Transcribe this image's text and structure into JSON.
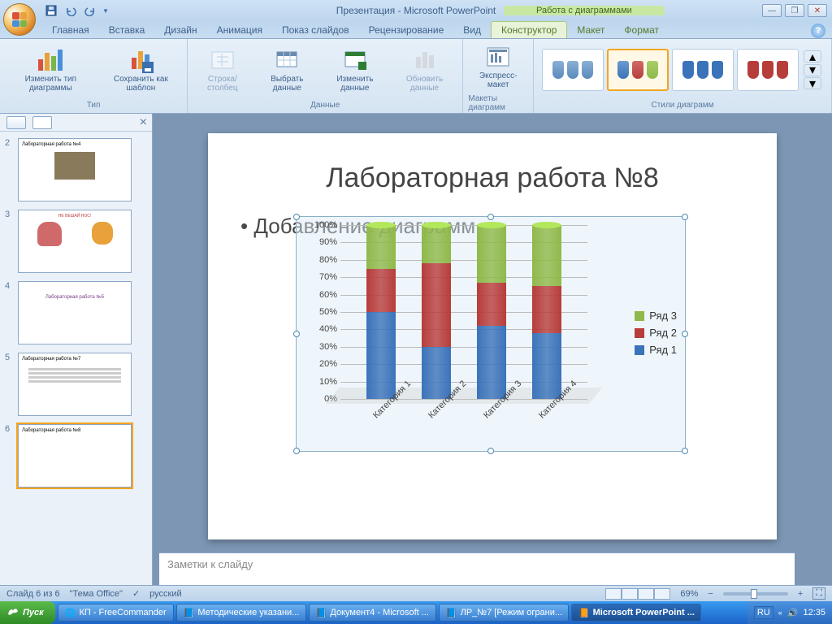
{
  "title_app": "Презентация - Microsoft PowerPoint",
  "title_context": "Работа с диаграммами",
  "tabs": {
    "home": "Главная",
    "insert": "Вставка",
    "design": "Дизайн",
    "anim": "Анимация",
    "slideshow": "Показ слайдов",
    "review": "Рецензирование",
    "view": "Вид",
    "chart_design": "Конструктор",
    "chart_layout": "Макет",
    "chart_format": "Формат"
  },
  "ribbon": {
    "type_group": "Тип",
    "change_type": "Изменить тип\nдиаграммы",
    "save_template": "Сохранить\nкак шаблон",
    "data_group": "Данные",
    "switch_rc": "Строка/столбец",
    "select_data": "Выбрать\nданные",
    "edit_data": "Изменить\nданные",
    "refresh_data": "Обновить\nданные",
    "layouts_group": "Макеты диаграмм",
    "express_layout": "Экспресс-макет",
    "styles_group": "Стили диаграмм"
  },
  "slide": {
    "title": "Лабораторная работа №8",
    "bullet": "Добавление диаграмм"
  },
  "legend": {
    "s1": "Ряд 1",
    "s2": "Ряд 2",
    "s3": "Ряд 3"
  },
  "notes_placeholder": "Заметки к слайду",
  "status": {
    "slide": "Слайд 6 из 6",
    "theme": "\"Тема Office\"",
    "lang": "русский",
    "zoom": "69%"
  },
  "thumbs": {
    "t2": "Лабораторная работа №4",
    "t4": "Лабораторная работа №5",
    "t5": "Лабораторная работа №7",
    "t6": "Лабораторная работа №8"
  },
  "taskbar": {
    "start": "Пуск",
    "t1": "КП - FreeCommander",
    "t2": "Методические указани...",
    "t3": "Документ4 - Microsoft ...",
    "t4": "ЛР_№7 [Режим ограни...",
    "t5": "Microsoft PowerPoint ...",
    "lang": "RU",
    "clock": "12:35"
  },
  "chart_data": {
    "type": "bar",
    "stacked": true,
    "percent": true,
    "categories": [
      "Категория 1",
      "Категория 2",
      "Категория 3",
      "Категория 4"
    ],
    "series": [
      {
        "name": "Ряд 1",
        "values": [
          50,
          30,
          42,
          38
        ],
        "color": "#3b73ba"
      },
      {
        "name": "Ряд 2",
        "values": [
          25,
          48,
          25,
          27
        ],
        "color": "#b73d3b"
      },
      {
        "name": "Ряд 3",
        "values": [
          25,
          22,
          33,
          35
        ],
        "color": "#8fb94a"
      }
    ],
    "ylabel": "",
    "ylim": [
      0,
      100
    ],
    "yticks": [
      "0%",
      "10%",
      "20%",
      "30%",
      "40%",
      "50%",
      "60%",
      "70%",
      "80%",
      "90%",
      "100%"
    ]
  }
}
